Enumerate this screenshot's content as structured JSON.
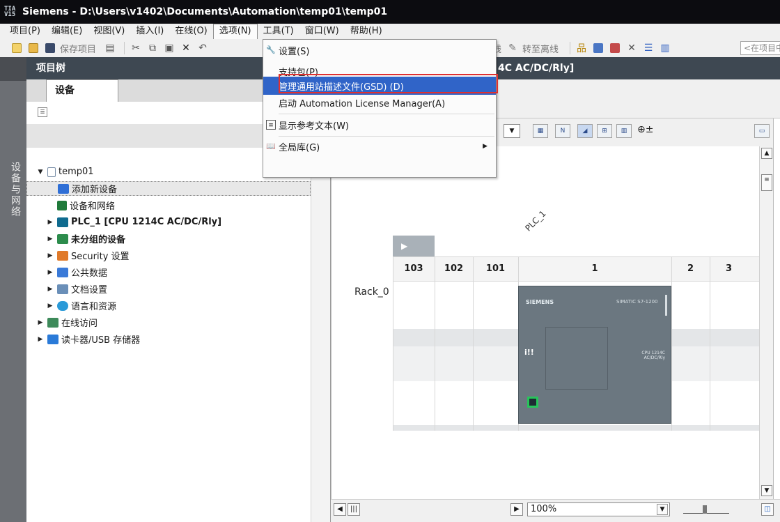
{
  "window": {
    "app_logo": "TIA V15",
    "title": "Siemens - D:\\Users\\v1402\\Documents\\Automation\\temp01\\temp01"
  },
  "menubar": {
    "items": [
      "项目(P)",
      "编辑(E)",
      "视图(V)",
      "插入(I)",
      "在线(O)",
      "选项(N)",
      "工具(T)",
      "窗口(W)",
      "帮助(H)"
    ]
  },
  "toolbar": {
    "save_project": "保存项目",
    "go_offline": "转至离线",
    "search_placeholder": "<在项目中"
  },
  "left_strip": {
    "label": "设备与网络"
  },
  "project_tree": {
    "header": "项目树",
    "tab": "设备",
    "items": [
      {
        "label": "temp01",
        "level": 0,
        "expanded": true
      },
      {
        "label": "添加新设备",
        "level": 1,
        "selected": true
      },
      {
        "label": "设备和网络",
        "level": 1
      },
      {
        "label": "PLC_1 [CPU 1214C AC/DC/Rly]",
        "level": 1,
        "expander": true
      },
      {
        "label": "未分组的设备",
        "level": 1,
        "expander": true,
        "bold": true
      },
      {
        "label": "Security 设置",
        "level": 1,
        "expander": true
      },
      {
        "label": "公共数据",
        "level": 1,
        "expander": true
      },
      {
        "label": "文档设置",
        "level": 1,
        "expander": true
      },
      {
        "label": "语言和资源",
        "level": 1,
        "expander": true
      },
      {
        "label": "在线访问",
        "level": 0,
        "expander": true
      },
      {
        "label": "读卡器/USB 存储器",
        "level": 0,
        "expander": true
      }
    ]
  },
  "editor": {
    "header_partial": "4C AC/DC/Rly]",
    "device_label": "PLC_1",
    "rack_label": "Rack_0",
    "slots": [
      "103",
      "102",
      "101",
      "1",
      "2",
      "3"
    ],
    "cpu": {
      "brand": "SIEMENS",
      "model": "SIMATIC S7-1200",
      "type": "CPU 1214C AC/DC/Rly"
    },
    "zoom": "100%"
  },
  "options_menu": {
    "items": [
      {
        "label": "设置(S)",
        "icon": "wrench-icon"
      },
      {
        "label": "支持包(P)"
      },
      {
        "label": "管理通用站描述文件(GSD) (D)",
        "highlighted": true
      },
      {
        "label": "启动 Automation License Manager(A)"
      },
      {
        "label": "显示参考文本(W)",
        "icon": "reference-text-icon"
      },
      {
        "label": "全局库(G)",
        "icon": "library-icon",
        "submenu": true
      }
    ]
  },
  "colors": {
    "titlebar": "#0c0c10",
    "panel_header": "#3e4852",
    "menu_highlight": "#3064c8",
    "callout_outline": "#e03030"
  }
}
